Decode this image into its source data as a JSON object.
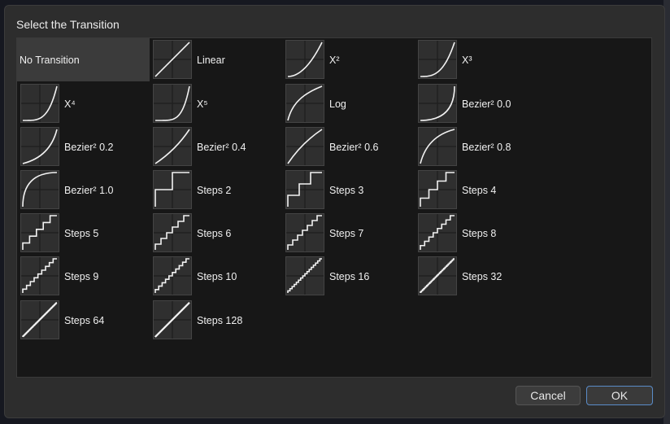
{
  "dialog": {
    "title": "Select the Transition",
    "cancel_label": "Cancel",
    "ok_label": "OK"
  },
  "transitions": [
    {
      "label": "No Transition",
      "icon": "none",
      "selected": true
    },
    {
      "label": "Linear",
      "icon": "linear-curve-icon"
    },
    {
      "label": "X²",
      "icon": "x2-curve-icon"
    },
    {
      "label": "X³",
      "icon": "x3-curve-icon"
    },
    {
      "label": "X⁴",
      "icon": "x4-curve-icon"
    },
    {
      "label": "X⁵",
      "icon": "x5-curve-icon"
    },
    {
      "label": "Log",
      "icon": "log-curve-icon"
    },
    {
      "label": "Bezier² 0.0",
      "icon": "bezier-curve-icon"
    },
    {
      "label": "Bezier² 0.2",
      "icon": "bezier-curve-icon"
    },
    {
      "label": "Bezier² 0.4",
      "icon": "bezier-curve-icon"
    },
    {
      "label": "Bezier² 0.6",
      "icon": "bezier-curve-icon"
    },
    {
      "label": "Bezier² 0.8",
      "icon": "bezier-curve-icon"
    },
    {
      "label": "Bezier² 1.0",
      "icon": "bezier-curve-icon"
    },
    {
      "label": "Steps 2",
      "icon": "steps-icon"
    },
    {
      "label": "Steps 3",
      "icon": "steps-icon"
    },
    {
      "label": "Steps 4",
      "icon": "steps-icon"
    },
    {
      "label": "Steps 5",
      "icon": "steps-icon"
    },
    {
      "label": "Steps 6",
      "icon": "steps-icon"
    },
    {
      "label": "Steps 7",
      "icon": "steps-icon"
    },
    {
      "label": "Steps 8",
      "icon": "steps-icon"
    },
    {
      "label": "Steps 9",
      "icon": "steps-icon"
    },
    {
      "label": "Steps 10",
      "icon": "steps-icon"
    },
    {
      "label": "Steps 16",
      "icon": "steps-icon"
    },
    {
      "label": "Steps 32",
      "icon": "steps-icon"
    },
    {
      "label": "Steps 64",
      "icon": "steps-icon"
    },
    {
      "label": "Steps 128",
      "icon": "steps-icon"
    }
  ]
}
